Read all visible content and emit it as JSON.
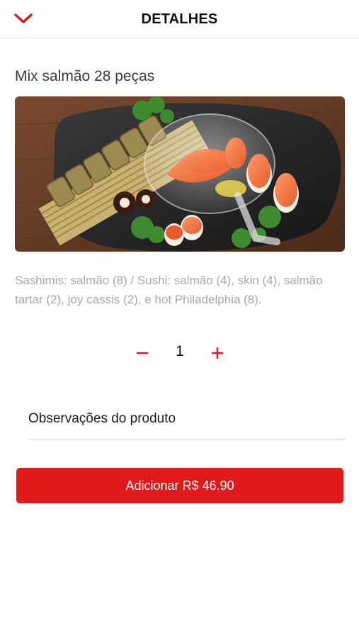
{
  "header": {
    "title": "DETALHES",
    "back_icon": "chevron-down-icon"
  },
  "product": {
    "name": "Mix salmão 28 peças",
    "description": "Sashimis: salmão (8) / Sushi: salmão (4), skin (4), salmão tartar (2), joy cassis (2), e hot Philadelphia (8).",
    "quantity": "1"
  },
  "observations": {
    "label": "Observações do produto"
  },
  "add_button": {
    "label": "Adicionar R$ 46.90"
  },
  "colors": {
    "accent": "#e0191b",
    "description_text": "#a8a8a8",
    "title_text": "#111111"
  }
}
